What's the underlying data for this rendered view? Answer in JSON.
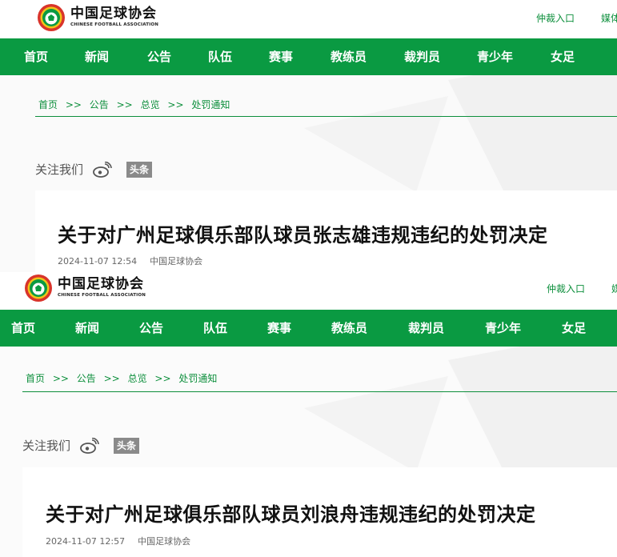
{
  "shared": {
    "brand": {
      "name_cn": "中国足球协会",
      "name_en": "CHINESE FOOTBALL ASSOCIATION"
    },
    "top_links": [
      "仲裁入口",
      "媒体"
    ],
    "nav": [
      "首页",
      "新闻",
      "公告",
      "队伍",
      "赛事",
      "教练员",
      "裁判员",
      "青少年",
      "女足"
    ],
    "breadcrumb": [
      "首页",
      ">>",
      "公告",
      ">>",
      "总览",
      ">>",
      "处罚通知"
    ],
    "follow_label": "关注我们",
    "toutiao_label": "头条"
  },
  "articles": [
    {
      "title": "关于对广州足球俱乐部队球员张志雄违规违纪的处罚决定",
      "date": "2024-11-07 12:54",
      "source": "中国足球协会"
    },
    {
      "title": "关于对广州足球俱乐部队球员刘浪舟违规违纪的处罚决定",
      "date": "2024-11-07 12:57",
      "source": "中国足球协会"
    }
  ],
  "colors": {
    "brand_green": "#0a9a42",
    "link_green": "#0d8f3c"
  }
}
